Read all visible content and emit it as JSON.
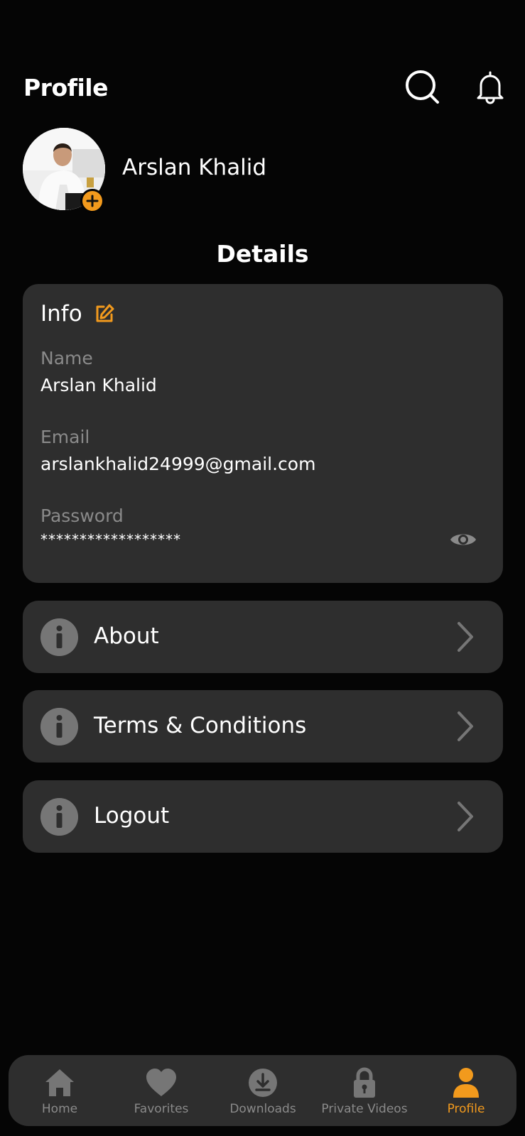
{
  "header": {
    "title": "Profile",
    "search_icon": "search-icon",
    "bell_icon": "bell-icon"
  },
  "profile": {
    "name": "Arslan Khalid",
    "avatar_add_icon": "plus-icon"
  },
  "details": {
    "title": "Details"
  },
  "info": {
    "title": "Info",
    "fields": [
      {
        "label": "Name",
        "value": "Arslan Khalid"
      },
      {
        "label": "Email",
        "value": "arslankhalid24999@gmail.com"
      },
      {
        "label": "Password",
        "value": "******************"
      }
    ]
  },
  "menu": [
    {
      "label": "About",
      "icon": "info-icon"
    },
    {
      "label": "Terms & Conditions",
      "icon": "info-icon"
    },
    {
      "label": "Logout",
      "icon": "info-icon"
    }
  ],
  "nav": [
    {
      "label": "Home",
      "icon": "home-icon",
      "active": false
    },
    {
      "label": "Favorites",
      "icon": "heart-icon",
      "active": false
    },
    {
      "label": "Downloads",
      "icon": "download-icon",
      "active": false
    },
    {
      "label": "Private Videos",
      "icon": "lock-icon",
      "active": false
    },
    {
      "label": "Profile",
      "icon": "user-icon",
      "active": true
    }
  ],
  "colors": {
    "accent": "#f29a1d",
    "background": "#050505",
    "card": "#2e2e2e",
    "muted": "#8a8a8a",
    "icon_gray": "#767676"
  }
}
